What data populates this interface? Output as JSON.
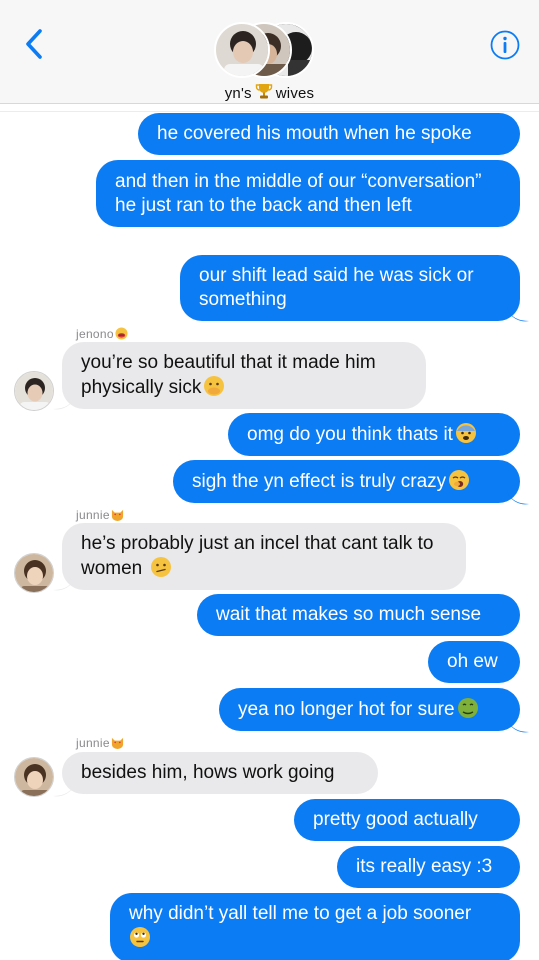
{
  "header": {
    "group_name_pre": "yn's",
    "group_name_post": "wives",
    "trophy_icon": "trophy-icon",
    "back_icon": "chevron-left-icon",
    "info_icon": "info-icon"
  },
  "colors": {
    "outgoing": "#0b7cf3",
    "incoming": "#e9e9eb",
    "accent": "#0b7cf3"
  },
  "messages": [
    {
      "dir": "out",
      "text": "he covered his mouth when he spoke"
    },
    {
      "dir": "out",
      "text": "and then in the middle of our “conversation” he just ran to the back and then left"
    },
    {
      "dir": "out",
      "text": "our shift lead said he was sick or something"
    },
    {
      "dir": "in",
      "sender": "jenono",
      "sender_emoji": "tongue-out-emoji",
      "text": "you’re so beautiful that it made him physically sick",
      "emoji": "face-with-hand-over-mouth-emoji"
    },
    {
      "dir": "out",
      "text": "omg do you think thats it",
      "emoji": "fearful-face-emoji"
    },
    {
      "dir": "out",
      "text": "sigh the yn effect is truly crazy",
      "emoji": "yawning-face-emoji"
    },
    {
      "dir": "in",
      "sender": "junnie",
      "sender_emoji": "heart-eyes-cat-emoji",
      "text": "he’s probably just an incel that cant talk to women",
      "emoji": "confused-face-emoji"
    },
    {
      "dir": "out",
      "text": "wait that makes so much sense"
    },
    {
      "dir": "out",
      "text": "oh ew"
    },
    {
      "dir": "out",
      "text": "yea no longer hot for sure",
      "emoji": "nauseated-face-emoji"
    },
    {
      "dir": "in",
      "sender": "junnie",
      "sender_emoji": "heart-eyes-cat-emoji",
      "text": "besides him, hows work going"
    },
    {
      "dir": "out",
      "text": "pretty good actually"
    },
    {
      "dir": "out",
      "text": "its really easy :3"
    },
    {
      "dir": "out",
      "text": "why didn’t yall tell me to get a job sooner",
      "emoji": "rolling-eyes-emoji"
    }
  ]
}
